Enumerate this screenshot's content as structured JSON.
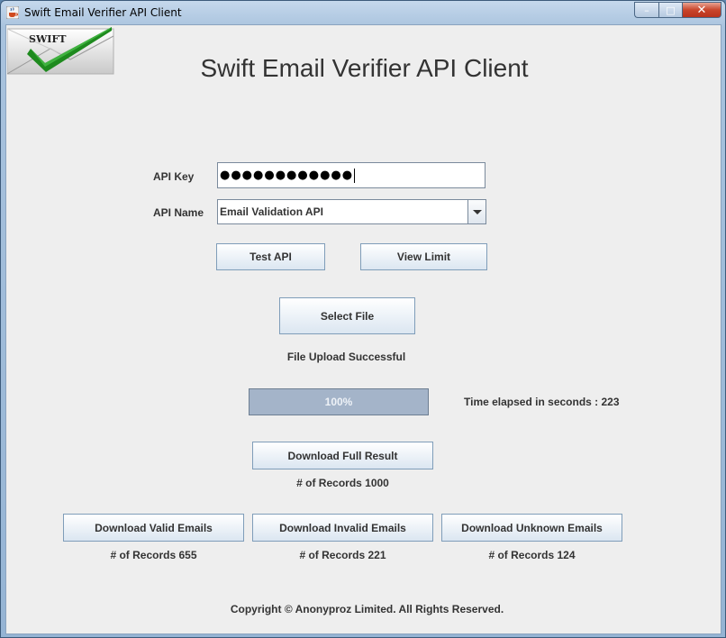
{
  "window": {
    "title": "Swift Email Verifier API Client",
    "controls": {
      "minimize": "–",
      "maximize": "□",
      "close": "✕"
    }
  },
  "logo": {
    "text": "SWIFT",
    "icon": "checkmark-envelope-icon"
  },
  "heading": "Swift Email Verifier API Client",
  "form": {
    "api_key_label": "API Key",
    "api_key_value": "●●●●●●●●●●●●",
    "api_name_label": "API Name",
    "api_name_value": "Email Validation API"
  },
  "buttons": {
    "test_api": "Test API",
    "view_limit": "View Limit",
    "select_file": "Select File",
    "download_full": "Download Full Result",
    "download_valid": "Download Valid Emails",
    "download_invalid": "Download Invalid Emails",
    "download_unknown": "Download Unknown Emails"
  },
  "status": {
    "upload": "File Upload Successful",
    "progress_text": "100%",
    "progress_value": 100,
    "time_elapsed": "Time elapsed in seconds : 223"
  },
  "records": {
    "full": "# of Records 1000",
    "valid": "# of Records 655",
    "invalid": "# of Records 221",
    "unknown": "# of Records 124"
  },
  "footer": "Copyright © Anonyproz Limited. All Rights Reserved.",
  "colors": {
    "accent": "#a4b4c9",
    "check_green": "#1e8a1e",
    "close_red": "#c9452b"
  }
}
